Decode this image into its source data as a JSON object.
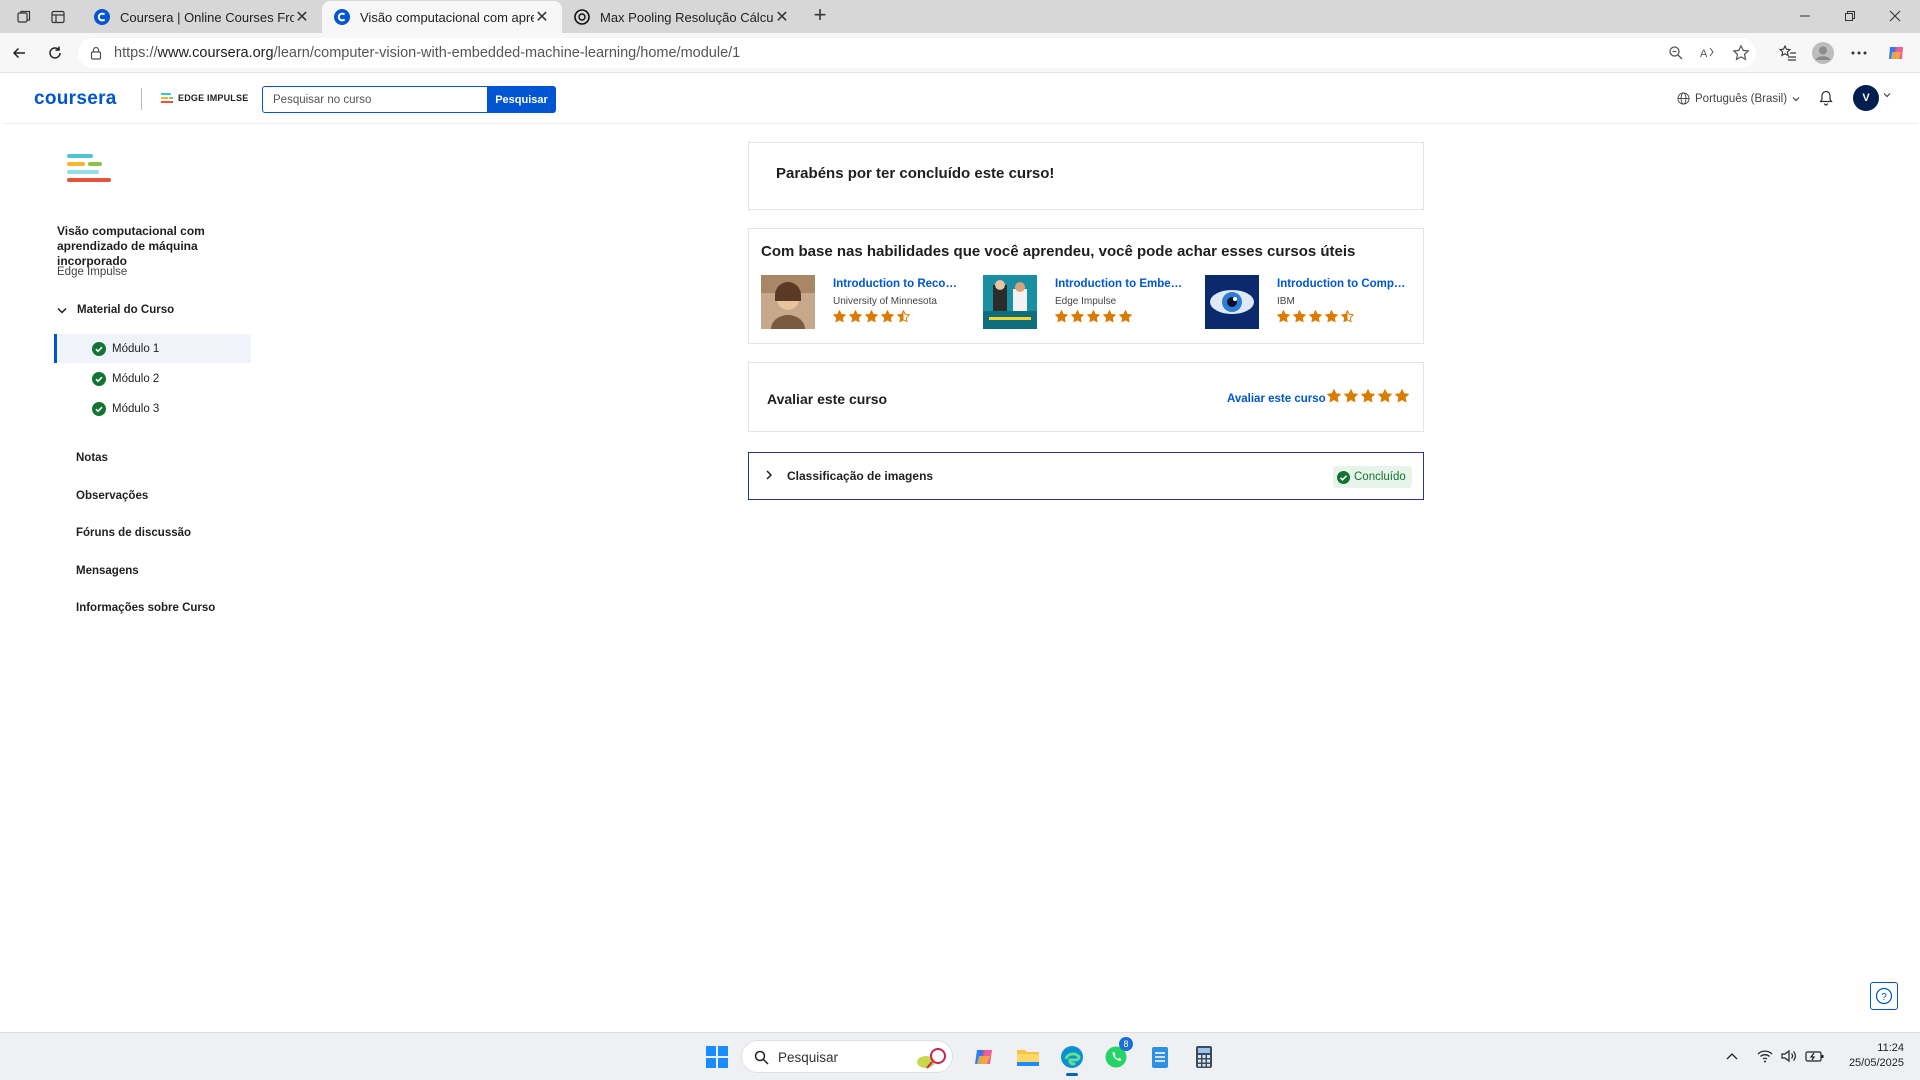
{
  "browser": {
    "tabs": [
      {
        "title": "Coursera | Online Courses From T",
        "active": false
      },
      {
        "title": "Visão computacional com aprend",
        "active": true
      },
      {
        "title": "Max Pooling Resolução Cálculo",
        "active": false
      }
    ],
    "url_prefix": "https://",
    "url_domain": "www.coursera.org",
    "url_path": "/learn/computer-vision-with-embedded-machine-learning/home/module/1"
  },
  "header": {
    "logo": "coursera",
    "partner": "EDGE IMPULSE",
    "search_placeholder": "Pesquisar no curso",
    "search_button": "Pesquisar",
    "language": "Português (Brasil)",
    "avatar_initial": "V"
  },
  "sidebar": {
    "course_title": "Visão computacional com aprendizado de máquina incorporado",
    "course_org": "Edge Impulse",
    "section_label": "Material do Curso",
    "modules": [
      {
        "label": "Módulo 1",
        "active": true,
        "completed": true
      },
      {
        "label": "Módulo 2",
        "active": false,
        "completed": true
      },
      {
        "label": "Módulo 3",
        "active": false,
        "completed": true
      }
    ],
    "links": [
      "Notas",
      "Observações",
      "Fóruns de discussão",
      "Mensagens",
      "Informações sobre Curso"
    ]
  },
  "main": {
    "congrats": "Parabéns por ter concluído este curso!",
    "recommend_heading": "Com base nas habilidades que você aprendeu, você pode achar esses cursos úteis",
    "recommendations": [
      {
        "title": "Introduction to Recom...",
        "org": "University of Minnesota",
        "rating": 4.5
      },
      {
        "title": "Introduction to Embed...",
        "org": "Edge Impulse",
        "rating": 5
      },
      {
        "title": "Introduction to Compu...",
        "org": "IBM",
        "rating": 4.5
      }
    ],
    "rate_label": "Avaliar este curso",
    "rate_link": "Avaliar este curso",
    "lesson_title": "Classificação de imagens",
    "lesson_status": "Concluído"
  },
  "taskbar": {
    "search_text": "Pesquisar",
    "whatsapp_badge": "8",
    "time": "11:24",
    "date": "25/05/2025"
  },
  "colors": {
    "brand": "#0056d2",
    "success": "#137333",
    "star": "#d97c00"
  }
}
